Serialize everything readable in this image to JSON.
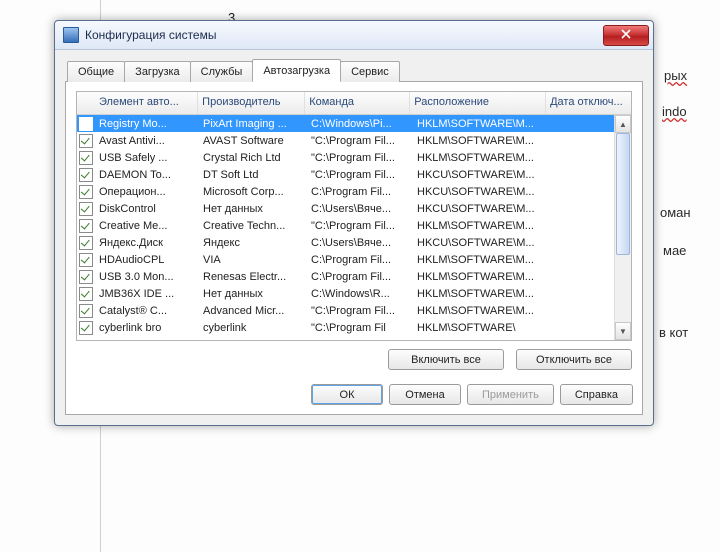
{
  "page_number": "3",
  "bg_fragments": {
    "a": "рых",
    "b": "indo",
    "c": "оман",
    "d": "мае",
    "e": "в кот"
  },
  "titlebar": {
    "title": "Конфигурация системы"
  },
  "tabs": {
    "items": [
      {
        "id": "general",
        "label": "Общие"
      },
      {
        "id": "boot",
        "label": "Загрузка"
      },
      {
        "id": "services",
        "label": "Службы"
      },
      {
        "id": "startup",
        "label": "Автозагрузка"
      },
      {
        "id": "tools",
        "label": "Сервис"
      }
    ],
    "active": "startup"
  },
  "listview": {
    "headers": {
      "element": "Элемент авто...",
      "vendor": "Производитель",
      "command": "Команда",
      "location": "Расположение",
      "disabled": "Дата отключ..."
    },
    "rows": [
      {
        "checked": true,
        "selected": true,
        "element": "Registry Mo...",
        "vendor": "PixArt Imaging ...",
        "command": "C:\\Windows\\Pi...",
        "location": "HKLM\\SOFTWARE\\M..."
      },
      {
        "checked": true,
        "selected": false,
        "element": "Avast Antivi...",
        "vendor": "AVAST Software",
        "command": "\"C:\\Program Fil...",
        "location": "HKLM\\SOFTWARE\\M..."
      },
      {
        "checked": true,
        "selected": false,
        "element": "USB Safely ...",
        "vendor": "Crystal Rich Ltd",
        "command": "\"C:\\Program Fil...",
        "location": "HKLM\\SOFTWARE\\M..."
      },
      {
        "checked": true,
        "selected": false,
        "element": "DAEMON To...",
        "vendor": "DT Soft Ltd",
        "command": "\"C:\\Program Fil...",
        "location": "HKCU\\SOFTWARE\\M..."
      },
      {
        "checked": true,
        "selected": false,
        "element": "Операцион...",
        "vendor": "Microsoft Corp...",
        "command": "C:\\Program Fil...",
        "location": "HKCU\\SOFTWARE\\M..."
      },
      {
        "checked": true,
        "selected": false,
        "element": "DiskControl",
        "vendor": "Нет данных",
        "command": "C:\\Users\\Вяче...",
        "location": "HKCU\\SOFTWARE\\M..."
      },
      {
        "checked": true,
        "selected": false,
        "element": "Creative Me...",
        "vendor": "Creative Techn...",
        "command": "\"C:\\Program Fil...",
        "location": "HKLM\\SOFTWARE\\M..."
      },
      {
        "checked": true,
        "selected": false,
        "element": "Яндекс.Диск",
        "vendor": "Яндекс",
        "command": "C:\\Users\\Вяче...",
        "location": "HKCU\\SOFTWARE\\M..."
      },
      {
        "checked": true,
        "selected": false,
        "element": "HDAudioCPL",
        "vendor": "VIA",
        "command": "C:\\Program Fil...",
        "location": "HKLM\\SOFTWARE\\M..."
      },
      {
        "checked": true,
        "selected": false,
        "element": "USB 3.0 Mon...",
        "vendor": "Renesas Electr...",
        "command": "C:\\Program Fil...",
        "location": "HKLM\\SOFTWARE\\M..."
      },
      {
        "checked": true,
        "selected": false,
        "element": "JMB36X IDE ...",
        "vendor": "Нет данных",
        "command": "C:\\Windows\\R...",
        "location": "HKLM\\SOFTWARE\\M..."
      },
      {
        "checked": true,
        "selected": false,
        "element": "Catalyst® C...",
        "vendor": "Advanced Micr...",
        "command": "\"C:\\Program Fil...",
        "location": "HKLM\\SOFTWARE\\M..."
      },
      {
        "checked": true,
        "selected": false,
        "element": "cyberlink bro",
        "vendor": "cyberlink",
        "command": "\"C:\\Program Fil",
        "location": "HKLM\\SOFTWARE\\"
      }
    ]
  },
  "buttons": {
    "enable_all": "Включить все",
    "disable_all": "Отключить все",
    "ok": "ОК",
    "cancel": "Отмена",
    "apply": "Применить",
    "help": "Справка"
  }
}
